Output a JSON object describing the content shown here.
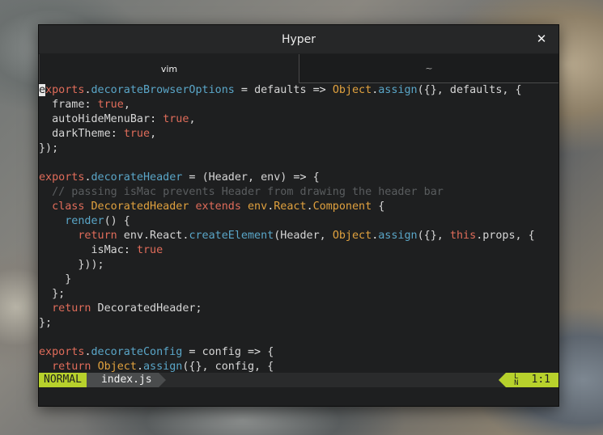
{
  "window": {
    "title": "Hyper"
  },
  "tabs": [
    {
      "label": "vim",
      "active": true
    },
    {
      "label": "~",
      "active": false
    }
  ],
  "editor": {
    "lines": [
      [
        {
          "t": "e",
          "c": "cursor"
        },
        {
          "t": "xports",
          "c": "kw"
        },
        {
          "t": ".",
          "c": "op"
        },
        {
          "t": "decorateBrowserOptions",
          "c": "fn"
        },
        {
          "t": " = ",
          "c": "op"
        },
        {
          "t": "defaults",
          "c": ""
        },
        {
          "t": " => ",
          "c": "op"
        },
        {
          "t": "Object",
          "c": "cls"
        },
        {
          "t": ".",
          "c": "op"
        },
        {
          "t": "assign",
          "c": "fn"
        },
        {
          "t": "({}, defaults, {",
          "c": ""
        }
      ],
      [
        {
          "t": "  frame",
          "c": ""
        },
        {
          "t": ": ",
          "c": "op"
        },
        {
          "t": "true",
          "c": "val"
        },
        {
          "t": ",",
          "c": ""
        }
      ],
      [
        {
          "t": "  autoHideMenuBar",
          "c": ""
        },
        {
          "t": ": ",
          "c": "op"
        },
        {
          "t": "true",
          "c": "val"
        },
        {
          "t": ",",
          "c": ""
        }
      ],
      [
        {
          "t": "  darkTheme",
          "c": ""
        },
        {
          "t": ": ",
          "c": "op"
        },
        {
          "t": "true",
          "c": "val"
        },
        {
          "t": ",",
          "c": ""
        }
      ],
      [
        {
          "t": "});",
          "c": ""
        }
      ],
      [],
      [
        {
          "t": "exports",
          "c": "kw"
        },
        {
          "t": ".",
          "c": "op"
        },
        {
          "t": "decorateHeader",
          "c": "fn"
        },
        {
          "t": " = ",
          "c": "op"
        },
        {
          "t": "(Header, env)",
          "c": ""
        },
        {
          "t": " => ",
          "c": "op"
        },
        {
          "t": "{",
          "c": ""
        }
      ],
      [
        {
          "t": "  // passing isMac prevents Header from drawing the header bar",
          "c": "cm"
        }
      ],
      [
        {
          "t": "  ",
          "c": ""
        },
        {
          "t": "class",
          "c": "kw"
        },
        {
          "t": " ",
          "c": ""
        },
        {
          "t": "DecoratedHeader",
          "c": "cls"
        },
        {
          "t": " ",
          "c": ""
        },
        {
          "t": "extends",
          "c": "kw"
        },
        {
          "t": " ",
          "c": ""
        },
        {
          "t": "env",
          "c": "cls"
        },
        {
          "t": ".",
          "c": "op"
        },
        {
          "t": "React",
          "c": "cls"
        },
        {
          "t": ".",
          "c": "op"
        },
        {
          "t": "Component",
          "c": "cls"
        },
        {
          "t": " {",
          "c": ""
        }
      ],
      [
        {
          "t": "    ",
          "c": ""
        },
        {
          "t": "render",
          "c": "fn"
        },
        {
          "t": "() {",
          "c": ""
        }
      ],
      [
        {
          "t": "      ",
          "c": ""
        },
        {
          "t": "return",
          "c": "kw"
        },
        {
          "t": " env.React.",
          "c": ""
        },
        {
          "t": "createElement",
          "c": "fn"
        },
        {
          "t": "(Header, ",
          "c": ""
        },
        {
          "t": "Object",
          "c": "cls"
        },
        {
          "t": ".",
          "c": "op"
        },
        {
          "t": "assign",
          "c": "fn"
        },
        {
          "t": "({}, ",
          "c": ""
        },
        {
          "t": "this",
          "c": "kw"
        },
        {
          "t": ".props, {",
          "c": ""
        }
      ],
      [
        {
          "t": "        isMac",
          "c": ""
        },
        {
          "t": ": ",
          "c": "op"
        },
        {
          "t": "true",
          "c": "val"
        }
      ],
      [
        {
          "t": "      }));",
          "c": ""
        }
      ],
      [
        {
          "t": "    }",
          "c": ""
        }
      ],
      [
        {
          "t": "  };",
          "c": ""
        }
      ],
      [
        {
          "t": "  ",
          "c": ""
        },
        {
          "t": "return",
          "c": "kw"
        },
        {
          "t": " DecoratedHeader;",
          "c": ""
        }
      ],
      [
        {
          "t": "};",
          "c": ""
        }
      ],
      [],
      [
        {
          "t": "exports",
          "c": "kw"
        },
        {
          "t": ".",
          "c": "op"
        },
        {
          "t": "decorateConfig",
          "c": "fn"
        },
        {
          "t": " = ",
          "c": "op"
        },
        {
          "t": "config",
          "c": ""
        },
        {
          "t": " => ",
          "c": "op"
        },
        {
          "t": "{",
          "c": ""
        }
      ],
      [
        {
          "t": "  ",
          "c": ""
        },
        {
          "t": "return",
          "c": "kw"
        },
        {
          "t": " ",
          "c": ""
        },
        {
          "t": "Object",
          "c": "cls"
        },
        {
          "t": ".",
          "c": "op"
        },
        {
          "t": "assign",
          "c": "fn"
        },
        {
          "t": "({}, config, {",
          "c": ""
        }
      ]
    ]
  },
  "statusbar": {
    "mode": "NORMAL",
    "filename": "index.js",
    "ln_icon_top": "L",
    "ln_icon_bottom": "N",
    "position": "1:1"
  },
  "colors": {
    "mode_bg": "#b7d12c",
    "keyword": "#e06c5a",
    "function": "#5aa6c8",
    "class": "#e0a13e"
  }
}
